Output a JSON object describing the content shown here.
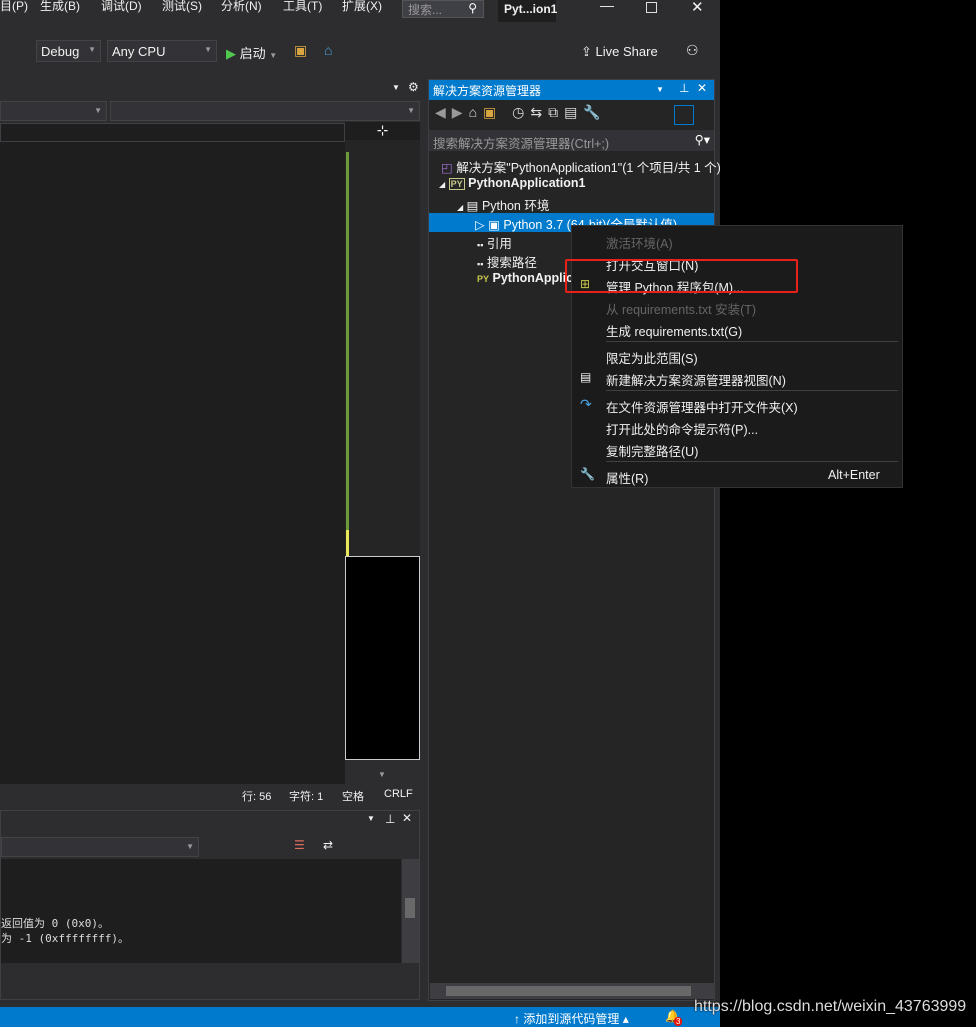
{
  "menu": [
    "目(P)",
    "生成(B)",
    "调试(D)",
    "测试(S)",
    "分析(N)",
    "工具(T)",
    "扩展(X)"
  ],
  "search_placeholder": "搜索...",
  "window_title": "Pyt...ion1",
  "toolbar": {
    "config": "Debug",
    "platform": "Any CPU",
    "start": "启动",
    "live_share": "Live Share"
  },
  "editor_status": {
    "line": "行: 56",
    "char": "字符: 1",
    "spaces": "空格",
    "eol": "CRLF"
  },
  "output": {
    "lines": [
      "返回值为 0 (0x0)。",
      "为 -1 (0xffffffff)。"
    ]
  },
  "solution_explorer": {
    "title": "解决方案资源管理器",
    "search_placeholder": "搜索解决方案资源管理器(Ctrl+;)",
    "items": [
      "解决方案\"PythonApplication1\"(1 个项目/共 1 个)",
      "PythonApplication1",
      "Python 环境",
      "Python 3.7 (64-bit)(全局默认值)",
      "引用",
      "搜索路径",
      "PythonApplication1.py"
    ]
  },
  "context_menu": {
    "items": [
      {
        "label": "激活环境(A)",
        "disabled": true
      },
      {
        "label": "打开交互窗口(N)"
      },
      {
        "label": "管理 Python 程序包(M)...",
        "highlighted": true
      },
      {
        "label": "从 requirements.txt 安装(T)",
        "disabled": true
      },
      {
        "label": "生成 requirements.txt(G)"
      },
      {
        "label": "限定为此范围(S)"
      },
      {
        "label": "新建解决方案资源管理器视图(N)"
      },
      {
        "label": "在文件资源管理器中打开文件夹(X)"
      },
      {
        "label": "打开此处的命令提示符(P)..."
      },
      {
        "label": "复制完整路径(U)"
      },
      {
        "label": "属性(R)",
        "shortcut": "Alt+Enter"
      }
    ]
  },
  "statusbar": {
    "source_control": "添加到源代码管理",
    "notifications": "3"
  },
  "watermark": "https://blog.csdn.net/weixin_43763999",
  "colors": {
    "accent": "#007acc",
    "highlight_box": "#e8221b"
  }
}
